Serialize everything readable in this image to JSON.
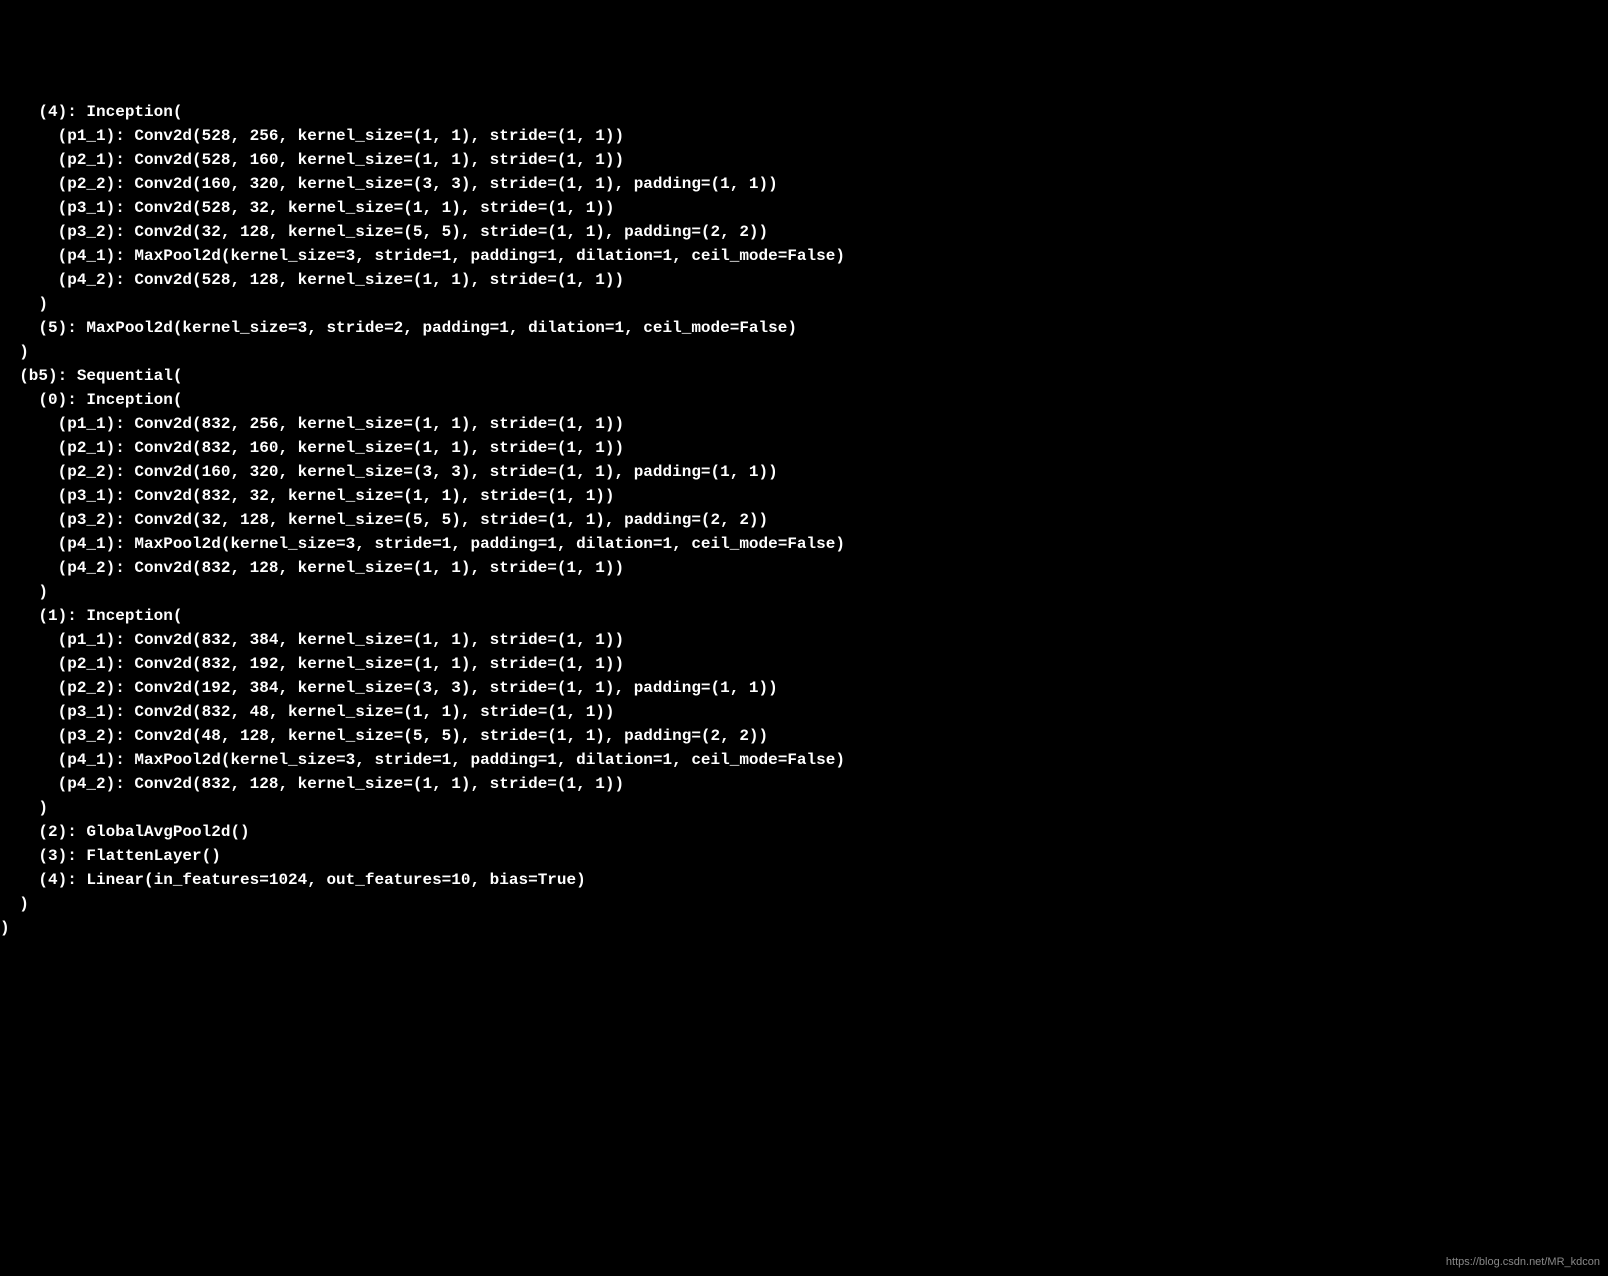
{
  "lines": [
    "    (4): Inception(",
    "      (p1_1): Conv2d(528, 256, kernel_size=(1, 1), stride=(1, 1))",
    "      (p2_1): Conv2d(528, 160, kernel_size=(1, 1), stride=(1, 1))",
    "      (p2_2): Conv2d(160, 320, kernel_size=(3, 3), stride=(1, 1), padding=(1, 1))",
    "      (p3_1): Conv2d(528, 32, kernel_size=(1, 1), stride=(1, 1))",
    "      (p3_2): Conv2d(32, 128, kernel_size=(5, 5), stride=(1, 1), padding=(2, 2))",
    "      (p4_1): MaxPool2d(kernel_size=3, stride=1, padding=1, dilation=1, ceil_mode=False)",
    "      (p4_2): Conv2d(528, 128, kernel_size=(1, 1), stride=(1, 1))",
    "    )",
    "    (5): MaxPool2d(kernel_size=3, stride=2, padding=1, dilation=1, ceil_mode=False)",
    "  )",
    "  (b5): Sequential(",
    "    (0): Inception(",
    "      (p1_1): Conv2d(832, 256, kernel_size=(1, 1), stride=(1, 1))",
    "      (p2_1): Conv2d(832, 160, kernel_size=(1, 1), stride=(1, 1))",
    "      (p2_2): Conv2d(160, 320, kernel_size=(3, 3), stride=(1, 1), padding=(1, 1))",
    "      (p3_1): Conv2d(832, 32, kernel_size=(1, 1), stride=(1, 1))",
    "      (p3_2): Conv2d(32, 128, kernel_size=(5, 5), stride=(1, 1), padding=(2, 2))",
    "      (p4_1): MaxPool2d(kernel_size=3, stride=1, padding=1, dilation=1, ceil_mode=False)",
    "      (p4_2): Conv2d(832, 128, kernel_size=(1, 1), stride=(1, 1))",
    "    )",
    "    (1): Inception(",
    "      (p1_1): Conv2d(832, 384, kernel_size=(1, 1), stride=(1, 1))",
    "      (p2_1): Conv2d(832, 192, kernel_size=(1, 1), stride=(1, 1))",
    "      (p2_2): Conv2d(192, 384, kernel_size=(3, 3), stride=(1, 1), padding=(1, 1))",
    "      (p3_1): Conv2d(832, 48, kernel_size=(1, 1), stride=(1, 1))",
    "      (p3_2): Conv2d(48, 128, kernel_size=(5, 5), stride=(1, 1), padding=(2, 2))",
    "      (p4_1): MaxPool2d(kernel_size=3, stride=1, padding=1, dilation=1, ceil_mode=False)",
    "      (p4_2): Conv2d(832, 128, kernel_size=(1, 1), stride=(1, 1))",
    "    )",
    "    (2): GlobalAvgPool2d()",
    "    (3): FlattenLayer()",
    "    (4): Linear(in_features=1024, out_features=10, bias=True)",
    "  )",
    ")"
  ],
  "watermark": "https://blog.csdn.net/MR_kdcon"
}
